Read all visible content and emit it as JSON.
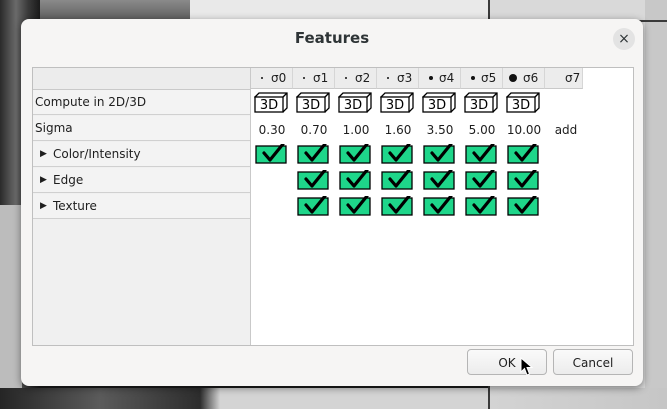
{
  "dialog": {
    "title": "Features",
    "close_glyph": "×",
    "ok_label": "OK",
    "cancel_label": "Cancel"
  },
  "columns": [
    {
      "label": "σ0",
      "dot": "tiny"
    },
    {
      "label": "σ1",
      "dot": "tiny"
    },
    {
      "label": "σ2",
      "dot": "tiny"
    },
    {
      "label": "σ3",
      "dot": "tiny"
    },
    {
      "label": "σ4",
      "dot": "small"
    },
    {
      "label": "σ5",
      "dot": "small"
    },
    {
      "label": "σ6",
      "dot": "large"
    },
    {
      "label": "σ7",
      "dot": "none"
    }
  ],
  "rows": {
    "compute": {
      "label": "Compute in 2D/3D",
      "button_text": "3D"
    },
    "sigma": {
      "label": "Sigma",
      "values": [
        "0.30",
        "0.70",
        "1.00",
        "1.60",
        "3.50",
        "5.00",
        "10.00",
        "add"
      ]
    },
    "color": {
      "label": "Color/Intensity",
      "expander": "▶"
    },
    "edge": {
      "label": "Edge",
      "expander": "▶"
    },
    "texture": {
      "label": "Texture",
      "expander": "▶"
    }
  },
  "checked": {
    "color": [
      true,
      true,
      true,
      true,
      true,
      true,
      true
    ],
    "edge": [
      false,
      true,
      true,
      true,
      true,
      true,
      true
    ],
    "texture": [
      false,
      true,
      true,
      true,
      true,
      true,
      true
    ]
  },
  "colors": {
    "checkbox_fill": "#1ed68a",
    "check_mark": "#000000",
    "dialog_bg": "#f6f5f4"
  }
}
